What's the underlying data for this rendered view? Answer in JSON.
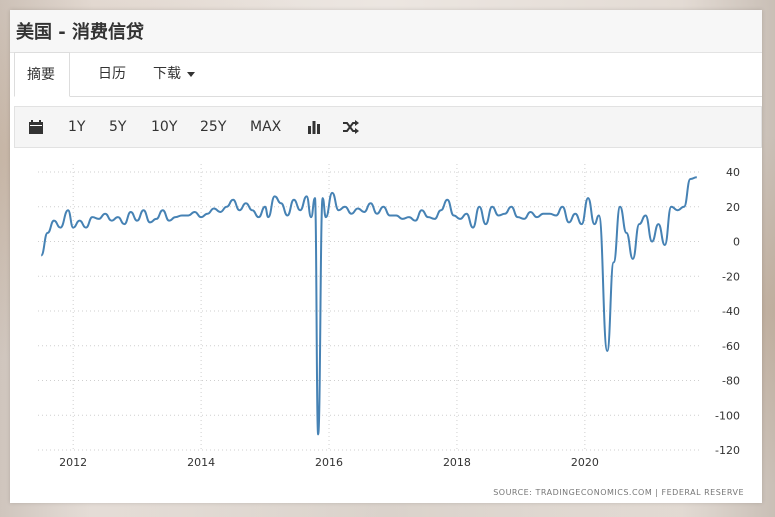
{
  "header": {
    "title": "美国 - 消费信贷"
  },
  "tabs": [
    {
      "label": "摘要",
      "active": true
    },
    {
      "label": "日历",
      "active": false
    },
    {
      "label": "下载",
      "active": false,
      "dropdown": true
    }
  ],
  "toolbar": {
    "calendar_icon": "calendar-icon",
    "ranges": [
      "1Y",
      "5Y",
      "10Y",
      "25Y",
      "MAX"
    ],
    "bar_chart_icon": "bar-chart-icon",
    "shuffle_icon": "shuffle-icon"
  },
  "chart_data": {
    "type": "line",
    "x_ticks": [
      "2012",
      "2014",
      "2016",
      "2018",
      "2020"
    ],
    "y_ticks": [
      40,
      20,
      0,
      -20,
      -40,
      -60,
      -80,
      -100,
      -120
    ],
    "ylim": [
      -120,
      40
    ],
    "grid": true,
    "axis_side": "right",
    "line_color": "#4682b4",
    "series": [
      {
        "name": "",
        "points": [
          [
            2011.5,
            -8
          ],
          [
            2011.6,
            5
          ],
          [
            2011.7,
            12
          ],
          [
            2011.8,
            8
          ],
          [
            2011.92,
            18
          ],
          [
            2012.0,
            8
          ],
          [
            2012.1,
            12
          ],
          [
            2012.2,
            8
          ],
          [
            2012.3,
            14
          ],
          [
            2012.4,
            13
          ],
          [
            2012.5,
            16
          ],
          [
            2012.6,
            12
          ],
          [
            2012.7,
            14
          ],
          [
            2012.8,
            10
          ],
          [
            2012.9,
            17
          ],
          [
            2013.0,
            12
          ],
          [
            2013.1,
            18
          ],
          [
            2013.2,
            11
          ],
          [
            2013.3,
            13
          ],
          [
            2013.4,
            18
          ],
          [
            2013.5,
            12
          ],
          [
            2013.6,
            14
          ],
          [
            2013.7,
            15
          ],
          [
            2013.8,
            15
          ],
          [
            2013.9,
            17
          ],
          [
            2014.0,
            14
          ],
          [
            2014.1,
            16
          ],
          [
            2014.2,
            19
          ],
          [
            2014.3,
            17
          ],
          [
            2014.4,
            20
          ],
          [
            2014.5,
            24
          ],
          [
            2014.6,
            18
          ],
          [
            2014.7,
            22
          ],
          [
            2014.8,
            18
          ],
          [
            2014.9,
            14
          ],
          [
            2015.0,
            20
          ],
          [
            2015.05,
            14
          ],
          [
            2015.15,
            26
          ],
          [
            2015.25,
            22
          ],
          [
            2015.35,
            15
          ],
          [
            2015.45,
            24
          ],
          [
            2015.55,
            18
          ],
          [
            2015.65,
            26
          ],
          [
            2015.72,
            14
          ],
          [
            2015.78,
            25
          ],
          [
            2015.83,
            -111
          ],
          [
            2015.9,
            25
          ],
          [
            2015.95,
            14
          ],
          [
            2016.05,
            28
          ],
          [
            2016.15,
            18
          ],
          [
            2016.25,
            20
          ],
          [
            2016.35,
            16
          ],
          [
            2016.45,
            19
          ],
          [
            2016.55,
            17
          ],
          [
            2016.65,
            22
          ],
          [
            2016.75,
            16
          ],
          [
            2016.85,
            20
          ],
          [
            2016.95,
            15
          ],
          [
            2017.05,
            15
          ],
          [
            2017.15,
            13
          ],
          [
            2017.25,
            14
          ],
          [
            2017.35,
            12
          ],
          [
            2017.45,
            18
          ],
          [
            2017.55,
            14
          ],
          [
            2017.65,
            13
          ],
          [
            2017.75,
            18
          ],
          [
            2017.85,
            24
          ],
          [
            2017.95,
            15
          ],
          [
            2018.05,
            13
          ],
          [
            2018.15,
            16
          ],
          [
            2018.25,
            8
          ],
          [
            2018.35,
            20
          ],
          [
            2018.45,
            10
          ],
          [
            2018.55,
            20
          ],
          [
            2018.65,
            15
          ],
          [
            2018.75,
            16
          ],
          [
            2018.85,
            20
          ],
          [
            2018.95,
            14
          ],
          [
            2019.05,
            13
          ],
          [
            2019.15,
            17
          ],
          [
            2019.25,
            14
          ],
          [
            2019.35,
            16
          ],
          [
            2019.45,
            16
          ],
          [
            2019.55,
            15
          ],
          [
            2019.65,
            20
          ],
          [
            2019.75,
            11
          ],
          [
            2019.85,
            16
          ],
          [
            2019.95,
            10
          ],
          [
            2020.05,
            25
          ],
          [
            2020.15,
            10
          ],
          [
            2020.22,
            15
          ],
          [
            2020.35,
            -63
          ],
          [
            2020.45,
            -12
          ],
          [
            2020.55,
            20
          ],
          [
            2020.65,
            5
          ],
          [
            2020.75,
            -10
          ],
          [
            2020.85,
            10
          ],
          [
            2020.95,
            15
          ],
          [
            2021.05,
            0
          ],
          [
            2021.15,
            10
          ],
          [
            2021.25,
            -2
          ],
          [
            2021.35,
            20
          ],
          [
            2021.45,
            18
          ],
          [
            2021.55,
            20
          ],
          [
            2021.65,
            36
          ],
          [
            2021.75,
            37
          ]
        ]
      }
    ],
    "source_text": "SOURCE: TRADINGECONOMICS.COM | FEDERAL RESERVE"
  }
}
